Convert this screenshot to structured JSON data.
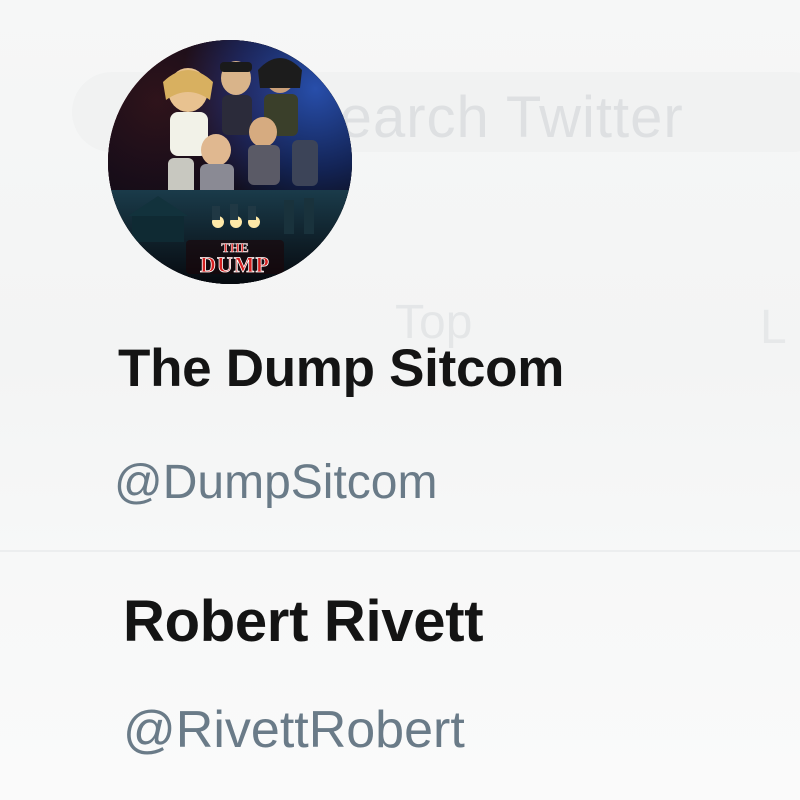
{
  "background_search": {
    "placeholder": "Search Twitter"
  },
  "background_tabs": {
    "tab_1": "Top",
    "tab_2": "L"
  },
  "accounts": [
    {
      "display_name": "The Dump Sitcom",
      "handle": "@DumpSitcom",
      "avatar_icon": "the-dump-poster-avatar",
      "avatar_logo_text": "THE DUMP"
    },
    {
      "display_name": "Robert Rivett",
      "handle": "@RivettRobert"
    }
  ],
  "colors": {
    "name_text": "#141414",
    "handle_text": "#6a7b88",
    "background": "#f5f6f6"
  }
}
